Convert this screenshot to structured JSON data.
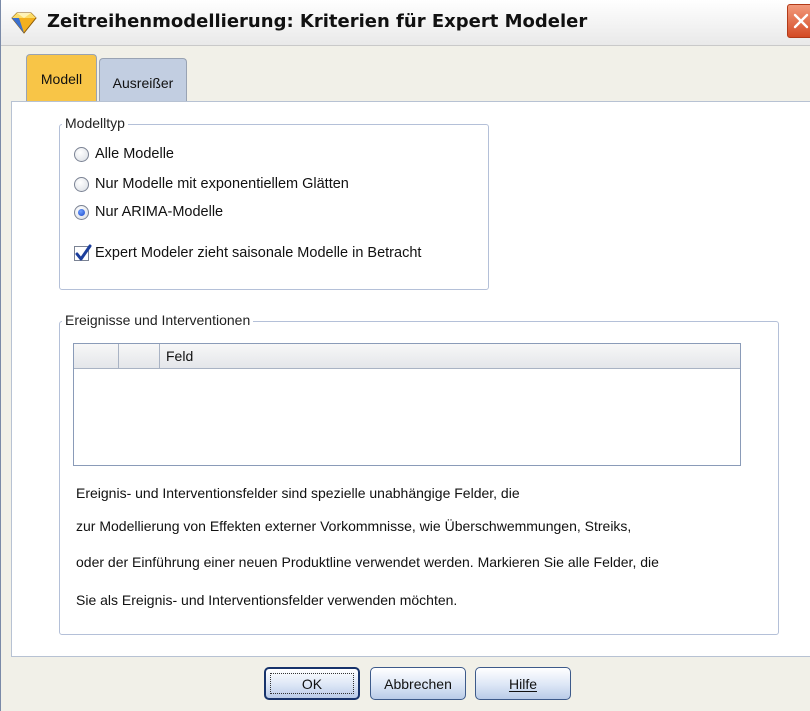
{
  "window": {
    "title": "Zeitreihenmodellierung: Kriterien für Expert Modeler"
  },
  "tabs": [
    {
      "label": "Modell",
      "active": true
    },
    {
      "label": "Ausreißer",
      "active": false
    }
  ],
  "modelltyp": {
    "legend": "Modelltyp",
    "options": [
      {
        "label": "Alle Modelle",
        "selected": false
      },
      {
        "label": "Nur Modelle mit exponentiellem Glätten",
        "selected": false
      },
      {
        "label": "Nur ARIMA-Modelle",
        "selected": true
      }
    ],
    "seasonal_checkbox": {
      "label": "Expert Modeler zieht saisonale Modelle in Betracht",
      "checked": true
    }
  },
  "events": {
    "legend": "Ereignisse und Interventionen",
    "table_header": {
      "col3": "Feld"
    },
    "description_lines": [
      "Ereignis- und Interventionsfelder sind spezielle unabhängige Felder, die",
      "zur Modellierung von Effekten externer Vorkommnisse, wie Überschwemmungen, Streiks,",
      "oder der Einführung einer neuen Produktline verwendet werden. Markieren Sie alle Felder, die",
      "Sie als Ereignis- und Interventionsfelder verwenden möchten."
    ]
  },
  "buttons": {
    "ok": "OK",
    "cancel": "Abbrechen",
    "help": "Hilfe"
  },
  "colors": {
    "active_tab": "#f8c547",
    "inactive_tab": "#c2cee1",
    "close_button": "#d44b25"
  },
  "icons": {
    "app": "spss-modeler-diamond-icon",
    "close": "close-x-icon"
  }
}
